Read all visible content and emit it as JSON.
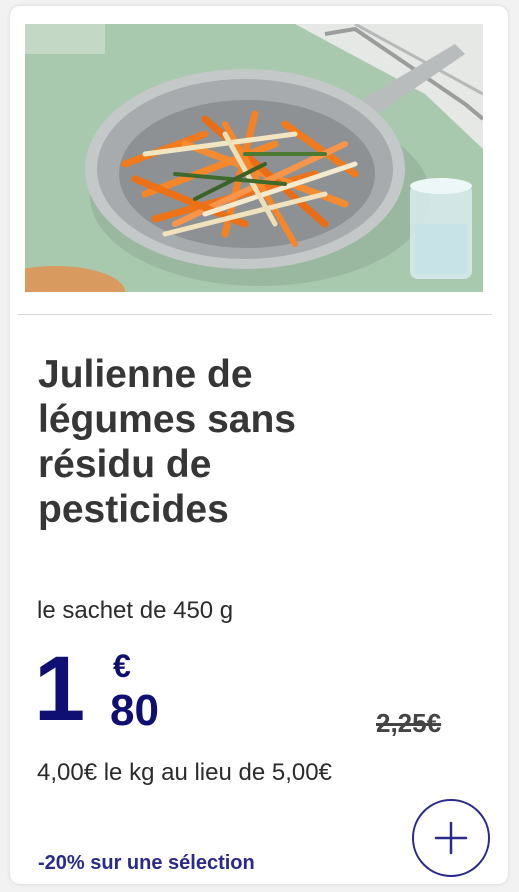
{
  "product": {
    "image_icon": "julienne-vegetables-pan-photo",
    "title": "Julienne de\nlégumes sans\nrésidu de\npesticides",
    "unit": "le sachet de 450 g"
  },
  "price": {
    "integer": "1",
    "currency": "€",
    "cents": "80",
    "old_price": "2,25€",
    "per_kg": "4,00€ le kg au lieu de 5,00€"
  },
  "promo": {
    "text": "-20% sur une sélection"
  },
  "actions": {
    "add_icon": "plus-icon"
  },
  "colors": {
    "price": "#0f0f73",
    "accent": "#2a2a8a",
    "background_green": "#a9cbb0"
  }
}
